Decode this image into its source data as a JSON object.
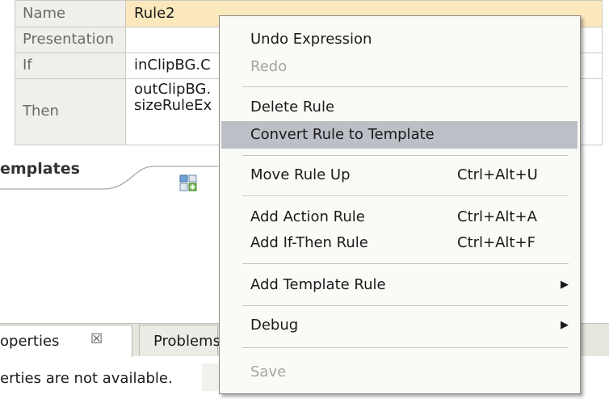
{
  "properties": {
    "rows": [
      {
        "name": "Name",
        "value": "Rule2"
      },
      {
        "name": "Presentation",
        "value": ""
      },
      {
        "name": "If",
        "value": "inClipBG.C"
      },
      {
        "name": "Then",
        "value_line1": "outClipBG.",
        "value_line2": "sizeRuleEx"
      }
    ]
  },
  "templates": {
    "title": "emplates",
    "icon": "add-template-icon"
  },
  "bottom_tabs": {
    "properties_label": "operties",
    "properties_close_glyph": "☒",
    "problems_label": "Problems",
    "status_text": "erties are not available."
  },
  "context_menu": {
    "items": [
      {
        "label": "Undo Expression",
        "shortcut": "",
        "enabled": true
      },
      {
        "label": "Redo",
        "shortcut": "",
        "enabled": false
      },
      {
        "label": "Delete Rule",
        "shortcut": "",
        "enabled": true
      },
      {
        "label": "Convert Rule to Template",
        "shortcut": "",
        "enabled": true,
        "highlighted": true
      },
      {
        "label": "Move Rule Up",
        "shortcut": "Ctrl+Alt+U",
        "enabled": true
      },
      {
        "label": "Add Action Rule",
        "shortcut": "Ctrl+Alt+A",
        "enabled": true
      },
      {
        "label": "Add If-Then Rule",
        "shortcut": "Ctrl+Alt+F",
        "enabled": true
      },
      {
        "label": "Add Template Rule",
        "shortcut": "",
        "enabled": true,
        "submenu": true
      },
      {
        "label": "Debug",
        "shortcut": "",
        "enabled": true,
        "submenu": true
      },
      {
        "label": "Save",
        "shortcut": "",
        "enabled": false
      }
    ],
    "submenu_arrow": "▶"
  },
  "colors": {
    "selection": "#fbe8bd",
    "menu_highlight": "#bdbfc7",
    "disabled_text": "#a4a4a0"
  }
}
